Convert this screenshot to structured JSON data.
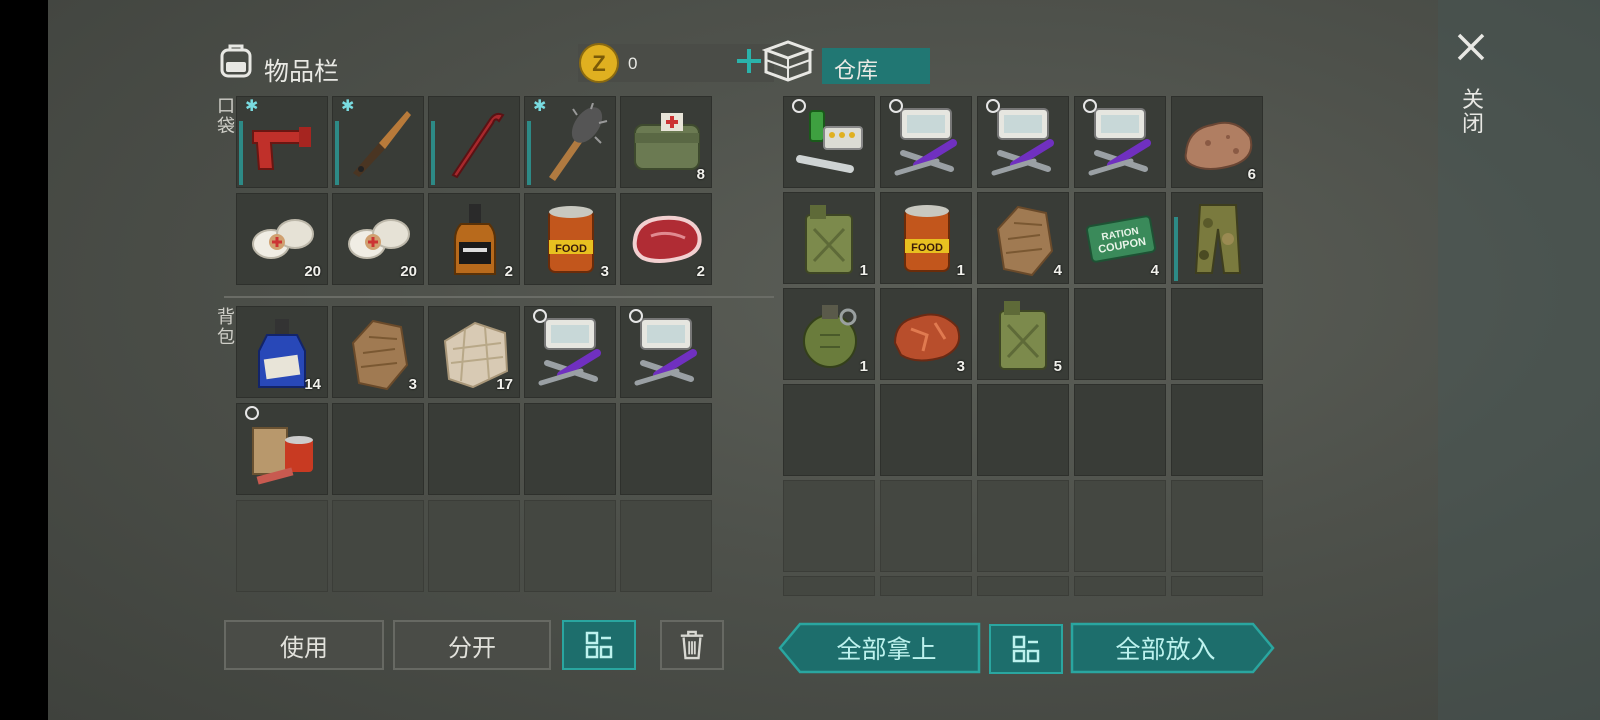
{
  "inventory": {
    "title": "物品栏",
    "coin_count": "0",
    "pocket_label": "口袋",
    "backpack_label": "背包",
    "pocket": [
      {
        "item": "flare-gun",
        "count": "",
        "frost": true,
        "bar": true
      },
      {
        "item": "knife",
        "count": "",
        "frost": true,
        "bar": true
      },
      {
        "item": "crowbar",
        "count": "",
        "frost": false,
        "bar": true
      },
      {
        "item": "spiked-club",
        "count": "",
        "frost": true,
        "bar": true
      },
      {
        "item": "medic-bag",
        "count": "8",
        "frost": false,
        "bar": false
      },
      {
        "item": "bandage",
        "count": "20"
      },
      {
        "item": "bandage",
        "count": "20"
      },
      {
        "item": "whiskey-bottle",
        "count": "2"
      },
      {
        "item": "food-can",
        "count": "3"
      },
      {
        "item": "steak",
        "count": "2"
      }
    ],
    "backpack": [
      {
        "item": "blue-bottle",
        "count": "14"
      },
      {
        "item": "fur-pelt",
        "count": "3"
      },
      {
        "item": "cloth-scrap",
        "count": "17"
      },
      {
        "item": "toolkit",
        "count": "",
        "timer": true
      },
      {
        "item": "toolkit",
        "count": "",
        "timer": true
      },
      {
        "item": "food-bundle",
        "count": "",
        "timer": true
      }
    ],
    "buttons": {
      "use": "使用",
      "split": "分开"
    }
  },
  "storage": {
    "title": "仓库",
    "slots": [
      {
        "item": "medkit-supplies",
        "count": "",
        "timer": true
      },
      {
        "item": "toolkit",
        "count": "",
        "timer": true
      },
      {
        "item": "toolkit",
        "count": "",
        "timer": true
      },
      {
        "item": "toolkit",
        "count": "",
        "timer": true
      },
      {
        "item": "rock",
        "count": "6"
      },
      {
        "item": "jerrycan",
        "count": "1"
      },
      {
        "item": "food-can",
        "count": "1"
      },
      {
        "item": "fur-pelt",
        "count": "4"
      },
      {
        "item": "ration-coupon",
        "count": "4"
      },
      {
        "item": "camo-pants",
        "count": "",
        "bar": true
      },
      {
        "item": "grenade",
        "count": "1"
      },
      {
        "item": "copper-ore",
        "count": "3"
      },
      {
        "item": "jerrycan",
        "count": "5"
      }
    ],
    "buttons": {
      "take_all": "全部拿上",
      "put_all": "全部放入"
    }
  },
  "close_label": "关闭",
  "icons": {
    "backpack": "backpack-icon",
    "coin": "coin-icon",
    "add": "plus-icon",
    "storage": "storage-box-icon",
    "sort": "sort-grid-icon",
    "trash": "trash-icon",
    "close": "close-icon"
  },
  "colors": {
    "accent": "#2aa6a0",
    "teal_fill": "#1d6e6c",
    "slot": "#393c37",
    "coin": "#e0b020"
  }
}
